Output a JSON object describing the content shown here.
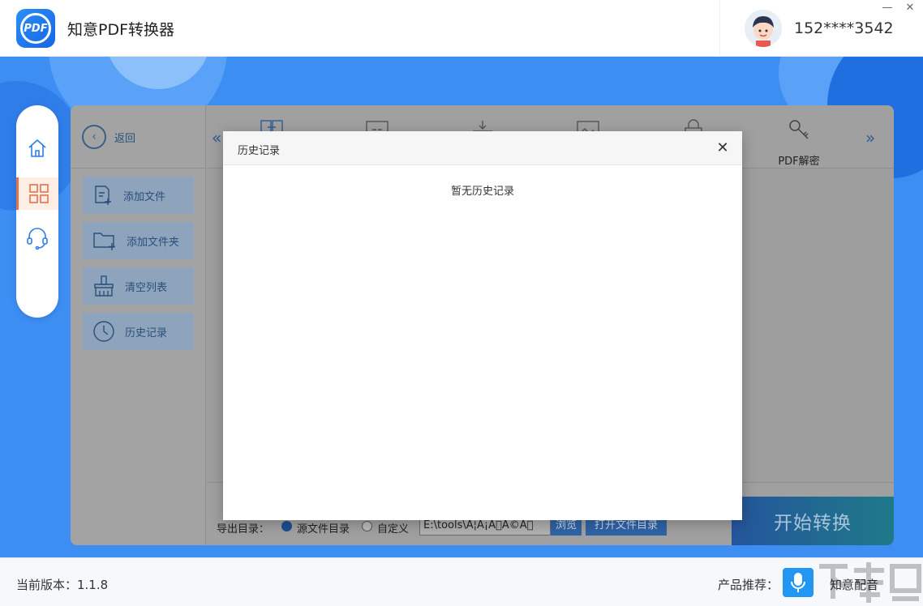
{
  "app": {
    "title": "知意PDF转换器",
    "logo_text": "PDF"
  },
  "user": {
    "phone": "152****3542"
  },
  "window": {
    "minimize": "—",
    "close": "✕"
  },
  "nav": {
    "items": [
      {
        "name": "home",
        "icon": "home-icon"
      },
      {
        "name": "apps",
        "icon": "grid-icon",
        "active": true
      },
      {
        "name": "support",
        "icon": "headset-icon"
      }
    ]
  },
  "sidebar": {
    "back_label": "返回",
    "buttons": [
      {
        "label": "添加文件",
        "icon": "add-file-icon"
      },
      {
        "label": "添加文件夹",
        "icon": "add-folder-icon"
      },
      {
        "label": "清空列表",
        "icon": "broom-icon"
      },
      {
        "label": "历史记录",
        "icon": "clock-icon"
      }
    ]
  },
  "toolbar": {
    "prev": "«",
    "next": "»",
    "items": [
      {
        "label": "PDF解密",
        "icon": "key-icon"
      }
    ]
  },
  "output": {
    "label": "导出目录：",
    "option_source": "源文件目录",
    "option_custom": "自定义",
    "selected": "源文件目录",
    "path": "E:\\tools\\A¦A¡A\u0000A©A\u0000",
    "browse_label": "浏览",
    "open_dir_label": "打开文件目录"
  },
  "start_button": "开始转换",
  "dialog": {
    "title": "历史记录",
    "close": "✕",
    "empty_text": "暂无历史记录"
  },
  "footer": {
    "version_label": "当前版本：1.1.8",
    "recommend_label": "产品推荐：",
    "recommend_name": "知意配音"
  },
  "colors": {
    "brand_blue": "#3d8ef3",
    "accent_orange": "#e8704a",
    "start_button": "#24559c"
  }
}
